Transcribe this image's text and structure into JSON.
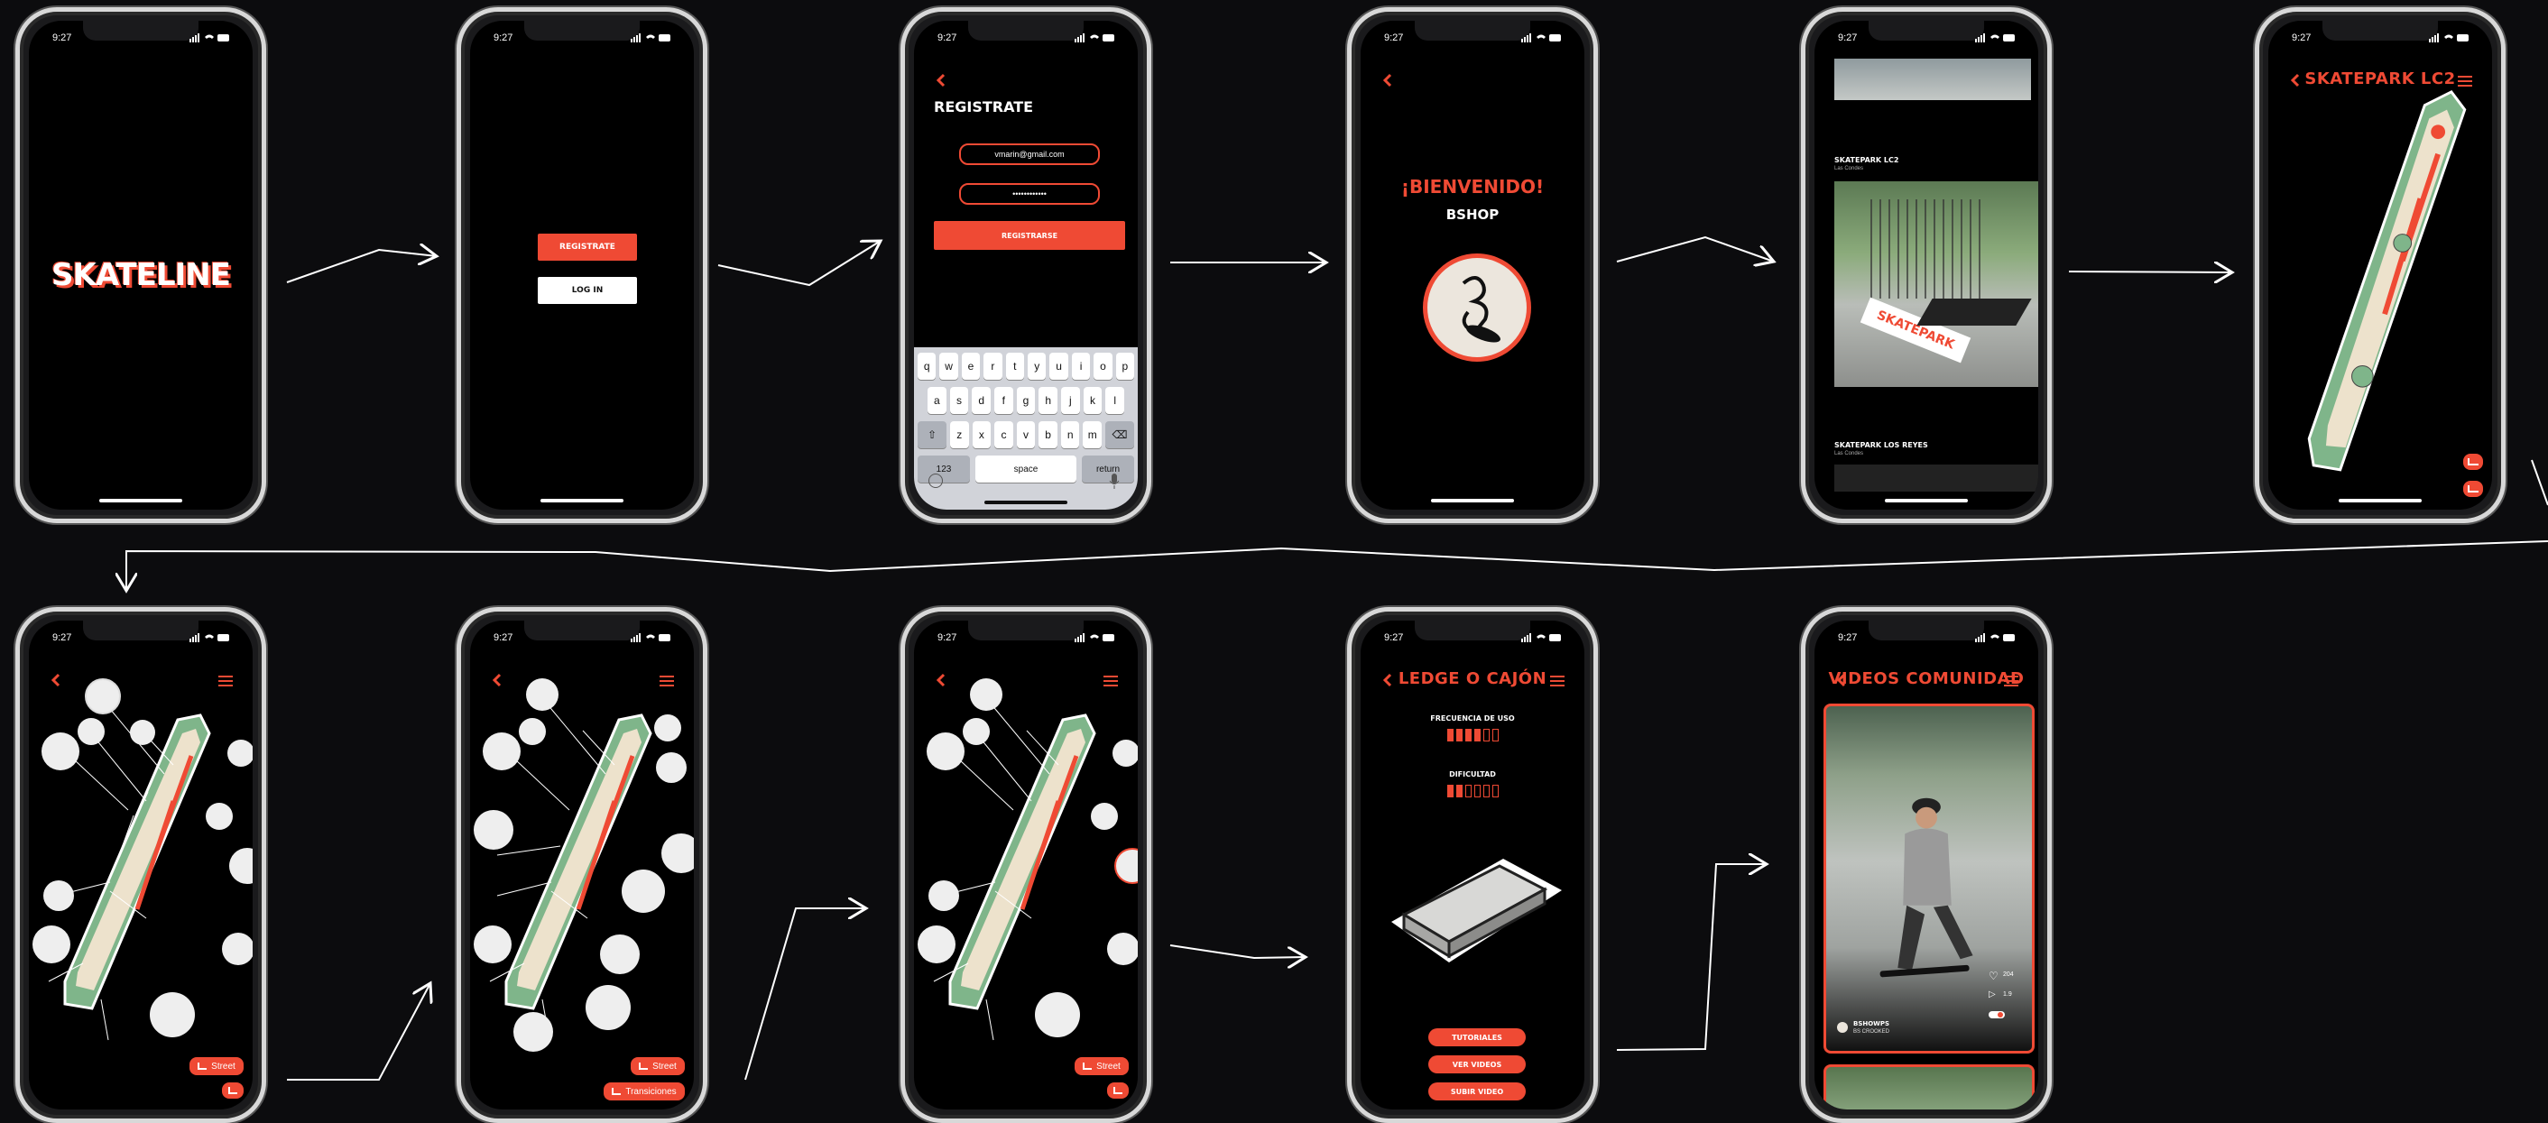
{
  "status_time": "9:27",
  "splash": {
    "logo": "SKATELINE"
  },
  "welcome": {
    "register_label": "REGISTRATE",
    "login_label": "LOG IN"
  },
  "register": {
    "heading": "REGISTRATE",
    "email_value": "vmarin@gmail.com",
    "password_value": "••••••••••••",
    "submit_label": "REGISTRARSE",
    "keyboard": {
      "row1": [
        "q",
        "w",
        "e",
        "r",
        "t",
        "y",
        "u",
        "i",
        "o",
        "p"
      ],
      "row2": [
        "a",
        "s",
        "d",
        "f",
        "g",
        "h",
        "j",
        "k",
        "l"
      ],
      "row3": [
        "z",
        "x",
        "c",
        "v",
        "b",
        "n",
        "m"
      ],
      "num_label": "123",
      "space_label": "space",
      "return_label": "return"
    }
  },
  "greeting": {
    "heading": "¡BIENVENIDO!",
    "name": "BSHOP"
  },
  "parks_list": {
    "items": [
      {
        "name": "SKATEPARK LC2",
        "location": "Las Condes"
      },
      {
        "name": "SKATEPARK LOS REYES",
        "location": "Las Condes"
      }
    ],
    "photo_banner": "SKATEPARK"
  },
  "park_map": {
    "title": "SKATEPARK LC2"
  },
  "map_street": {
    "filter_label": "Street"
  },
  "map_transitions": {
    "filter_street_label": "Street",
    "filter_trans_label": "Transiciones"
  },
  "map_street2": {
    "filter_label": "Street"
  },
  "obstacle": {
    "title": "LEDGE O CAJÓN",
    "freq_label": "FRECUENCIA DE USO",
    "freq_level": 4,
    "diff_label": "DIFICULTAD",
    "diff_level": 2,
    "level_max": 6,
    "buttons": [
      "TUTORIALES",
      "VER VIDEOS",
      "SUBIR VIDEO"
    ]
  },
  "videos": {
    "title": "VIDEOS COMUNIDAD",
    "user": "BSHOWPS",
    "trick": "BS CROOKED",
    "likes": "204",
    "plays": "1.9"
  },
  "colors": {
    "accent": "#ef4a34",
    "background": "#0c0c0e",
    "park_green": "#7fb58a",
    "park_sand": "#ede2cc"
  }
}
